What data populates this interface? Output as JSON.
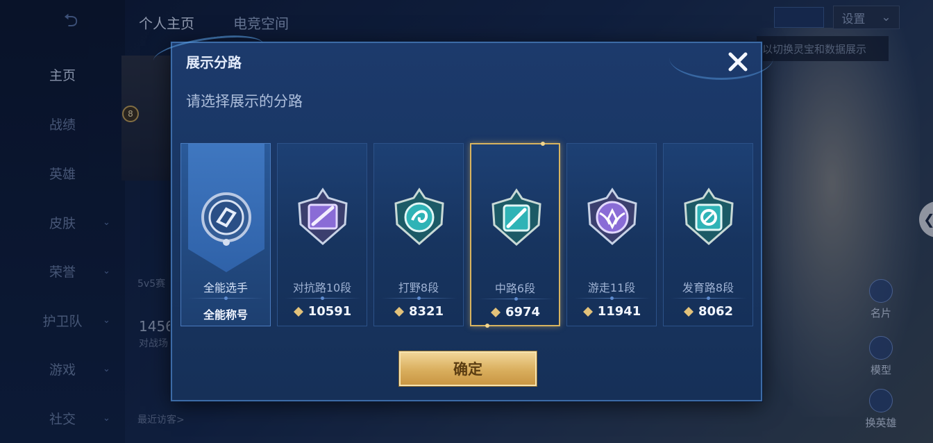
{
  "background": {
    "nav_items": [
      {
        "label": "主页",
        "chevron": false,
        "active": true
      },
      {
        "label": "战绩",
        "chevron": false,
        "active": false
      },
      {
        "label": "英雄",
        "chevron": false,
        "active": false
      },
      {
        "label": "皮肤",
        "chevron": true,
        "active": false
      },
      {
        "label": "荣誉",
        "chevron": true,
        "active": false
      },
      {
        "label": "护卫队",
        "chevron": true,
        "active": false
      },
      {
        "label": "游戏",
        "chevron": true,
        "active": false
      },
      {
        "label": "社交",
        "chevron": true,
        "active": false
      }
    ],
    "tabs": [
      "个人主页",
      "电竞空间"
    ],
    "settings_label": "设置",
    "tooltip_text": "以切换灵宝和数据展示",
    "level": "8",
    "mode_label": "5v5赛",
    "stat_value": "1456",
    "stat_label": "对战场",
    "recent_visitors": "最近访客>",
    "right_buttons": [
      "名片",
      "模型",
      "换英雄"
    ]
  },
  "modal": {
    "title": "展示分路",
    "subtitle": "请选择展示的分路",
    "confirm_label": "确定",
    "cards": [
      {
        "role": "全能选手",
        "value": "全能称号",
        "type": "title",
        "emblem": "all-round-icon"
      },
      {
        "role": "对抗路10段",
        "value": "10591",
        "type": "points",
        "emblem": "clash-lane-icon"
      },
      {
        "role": "打野8段",
        "value": "8321",
        "type": "points",
        "emblem": "jungle-icon"
      },
      {
        "role": "中路6段",
        "value": "6974",
        "type": "points",
        "emblem": "mid-lane-icon",
        "selected": true
      },
      {
        "role": "游走11段",
        "value": "11941",
        "type": "points",
        "emblem": "roam-icon"
      },
      {
        "role": "发育路8段",
        "value": "8062",
        "type": "points",
        "emblem": "farm-lane-icon"
      }
    ]
  },
  "colors": {
    "modal_bg": "#1c3a6c",
    "selected_border": "#d8b460",
    "confirm_gold": "#d9ae5d",
    "emblem_silver": "#c7d2e6",
    "emblem_purple": "#8a6cd6",
    "emblem_teal": "#2fb3b6"
  }
}
